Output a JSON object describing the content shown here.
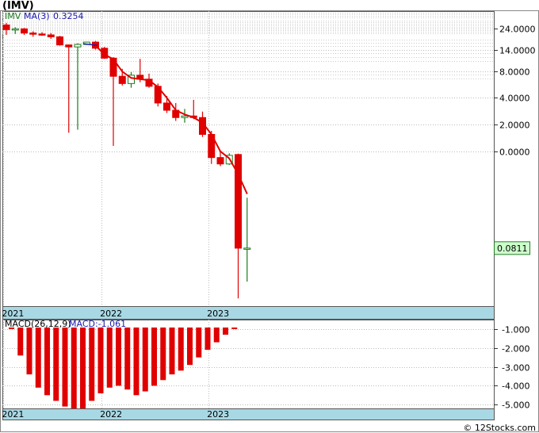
{
  "title": "(IMV)",
  "footer": "© 12Stocks.com",
  "colors": {
    "up": "#1a7a1a",
    "down": "#e00000",
    "ma": "#e00000",
    "last_price_bg": "#ccffcc",
    "axis_band": "#a8d8e4",
    "grid": "#bbbbbb",
    "legend_ticker": "#1a7a1a",
    "legend_ma": "#1a1ab0",
    "legend_macd": "#1a1ab0"
  },
  "chart_data": [
    {
      "type": "candlestick",
      "ticker": "IMV",
      "ma_label": "MA(3)",
      "ma_value": "0.3254",
      "last_price_label": "0.0811",
      "last_price": 0.0811,
      "y_scale": "log",
      "yticks": [
        "24.0000",
        "14.0000",
        "8.0000",
        "4.0000",
        "2.0000",
        "0.0000"
      ],
      "ytick_values": [
        24.0,
        14.0,
        8.0,
        4.0,
        2.0,
        1.0
      ],
      "ylim": [
        0.018,
        38.0
      ],
      "x_labels": [
        "2021",
        "2022",
        "2023"
      ],
      "x_label_index": [
        0,
        11,
        23
      ],
      "candles": [
        {
          "o": 26.5,
          "h": 28.0,
          "l": 20.5,
          "c": 23.5
        },
        {
          "o": 23.5,
          "h": 25.0,
          "l": 21.0,
          "c": 24.0
        },
        {
          "o": 24.0,
          "h": 24.5,
          "l": 20.5,
          "c": 21.5
        },
        {
          "o": 21.5,
          "h": 22.5,
          "l": 19.5,
          "c": 21.0
        },
        {
          "o": 21.0,
          "h": 22.0,
          "l": 20.0,
          "c": 20.5
        },
        {
          "o": 20.5,
          "h": 21.5,
          "l": 18.5,
          "c": 19.5
        },
        {
          "o": 19.5,
          "h": 20.0,
          "l": 15.5,
          "c": 15.8
        },
        {
          "o": 15.8,
          "h": 16.0,
          "l": 1.62,
          "c": 15.0
        },
        {
          "o": 15.0,
          "h": 16.5,
          "l": 1.75,
          "c": 16.0
        },
        {
          "o": 16.0,
          "h": 17.0,
          "l": 15.8,
          "c": 17.0
        },
        {
          "o": 17.0,
          "h": 17.5,
          "l": 14.0,
          "c": 14.5
        },
        {
          "o": 14.5,
          "h": 15.0,
          "l": 11.0,
          "c": 11.2
        },
        {
          "o": 11.2,
          "h": 11.5,
          "l": 1.15,
          "c": 7.0
        },
        {
          "o": 7.0,
          "h": 8.5,
          "l": 5.5,
          "c": 5.8
        },
        {
          "o": 5.8,
          "h": 7.8,
          "l": 5.2,
          "c": 7.2
        },
        {
          "o": 7.2,
          "h": 11.0,
          "l": 6.0,
          "c": 6.5
        },
        {
          "o": 6.5,
          "h": 7.5,
          "l": 5.2,
          "c": 5.4
        },
        {
          "o": 5.4,
          "h": 5.8,
          "l": 3.2,
          "c": 3.5
        },
        {
          "o": 3.5,
          "h": 4.2,
          "l": 2.7,
          "c": 2.9
        },
        {
          "o": 2.9,
          "h": 3.5,
          "l": 2.2,
          "c": 2.4
        },
        {
          "o": 2.4,
          "h": 3.0,
          "l": 2.1,
          "c": 2.5
        },
        {
          "o": 2.5,
          "h": 3.8,
          "l": 2.3,
          "c": 2.4
        },
        {
          "o": 2.4,
          "h": 2.8,
          "l": 1.45,
          "c": 1.55
        },
        {
          "o": 1.55,
          "h": 1.7,
          "l": 0.72,
          "c": 0.85
        },
        {
          "o": 0.85,
          "h": 1.0,
          "l": 0.68,
          "c": 0.72
        },
        {
          "o": 0.72,
          "h": 0.95,
          "l": 0.7,
          "c": 0.9
        },
        {
          "o": 0.92,
          "h": 0.94,
          "l": 0.022,
          "c": 0.081
        },
        {
          "o": 0.081,
          "h": 0.3,
          "l": 0.034,
          "c": 0.0811
        }
      ],
      "ma_start": 10,
      "ma": [
        15.6,
        12.3,
        10.9,
        7.9,
        6.7,
        6.5,
        6.3,
        5.3,
        4.0,
        2.9,
        2.6,
        2.4,
        2.1,
        1.55,
        1.0,
        0.83,
        0.55,
        0.33
      ]
    },
    {
      "type": "bar",
      "label": "MACD(26,12,9)",
      "value_label": "MACD:-1.061",
      "yticks": [
        "-1.000",
        "-2.000",
        "-3.000",
        "-4.000",
        "-5.000"
      ],
      "ytick_values": [
        -1.0,
        -2.0,
        -3.0,
        -4.0,
        -5.0
      ],
      "ylim": [
        -5.2,
        -0.5
      ],
      "x_labels": [
        "2021",
        "2022",
        "2023"
      ],
      "values": [
        -1.0,
        -2.4,
        -3.4,
        -4.1,
        -4.5,
        -4.8,
        -5.1,
        -5.4,
        -5.5,
        -4.8,
        -4.4,
        -4.1,
        -4.0,
        -4.2,
        -4.5,
        -4.3,
        -4.0,
        -3.7,
        -3.4,
        -3.2,
        -2.9,
        -2.5,
        -2.1,
        -1.7,
        -1.3,
        -1.0,
        -0.9
      ]
    }
  ]
}
